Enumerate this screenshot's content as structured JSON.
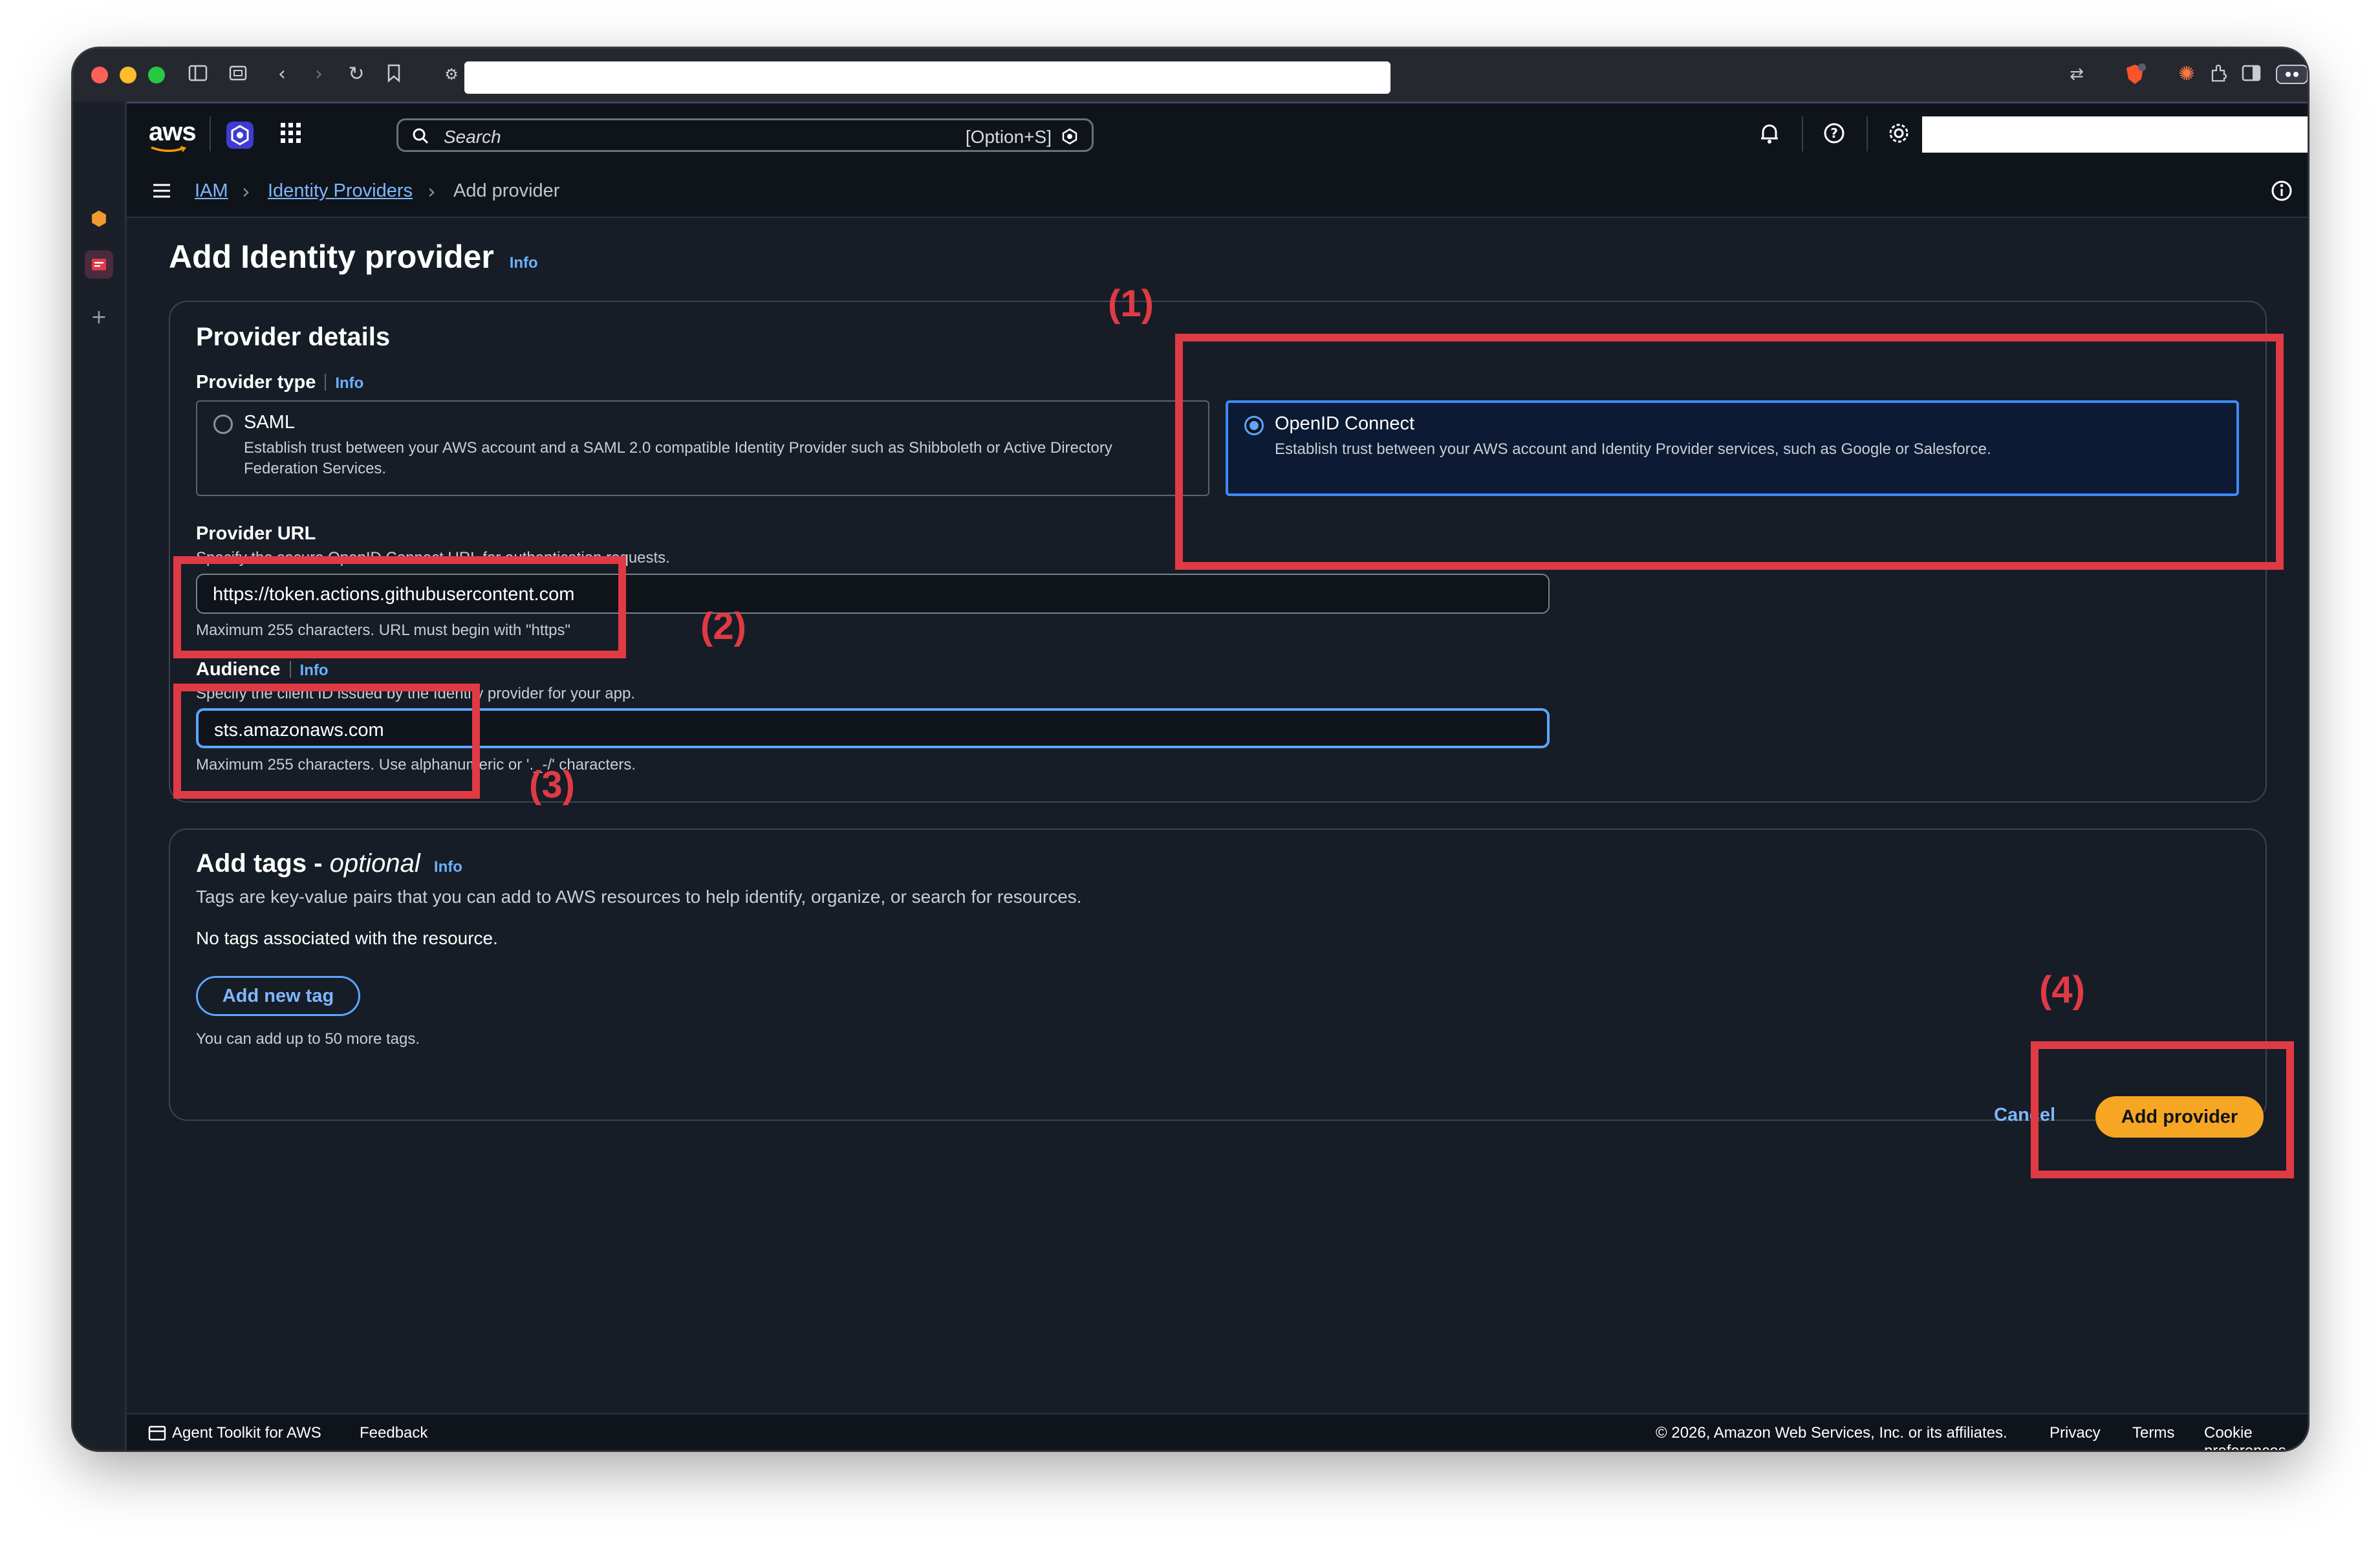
{
  "search": {
    "placeholder": "Search",
    "shortcut": "[Option+S]"
  },
  "breadcrumb": {
    "items": [
      "IAM",
      "Identity Providers",
      "Add provider"
    ]
  },
  "page": {
    "title": "Add Identity provider",
    "info": "Info"
  },
  "provider_details": {
    "heading": "Provider details",
    "provider_type_label": "Provider type",
    "info": "Info",
    "options": [
      {
        "title": "SAML",
        "description": "Establish trust between your AWS account and a SAML 2.0 compatible Identity Provider such as Shibboleth or Active Directory Federation Services.",
        "selected": false
      },
      {
        "title": "OpenID Connect",
        "description": "Establish trust between your AWS account and Identity Provider services, such as Google or Salesforce.",
        "selected": true
      }
    ],
    "provider_url": {
      "label": "Provider URL",
      "description": "Specify the secure OpenID Connect URL for authentication requests.",
      "value": "https://token.actions.githubusercontent.com",
      "constraint": "Maximum 255 characters. URL must begin with \"https\""
    },
    "audience": {
      "label": "Audience",
      "info": "Info",
      "description": "Specify the client ID issued by the Identity provider for your app.",
      "value": "sts.amazonaws.com",
      "constraint": "Maximum 255 characters. Use alphanumeric or '._-/' characters."
    }
  },
  "tags": {
    "heading_main": "Add tags - ",
    "heading_optional": "optional",
    "info": "Info",
    "description": "Tags are key-value pairs that you can add to AWS resources to help identify, organize, or search for resources.",
    "empty_text": "No tags associated with the resource.",
    "add_button": "Add new tag",
    "limit_text": "You can add up to 50 more tags."
  },
  "actions": {
    "cancel": "Cancel",
    "submit": "Add provider"
  },
  "annotations": [
    "(1)",
    "(2)",
    "(3)",
    "(4)"
  ],
  "footer": {
    "toolkit": "Agent Toolkit for AWS",
    "feedback": "Feedback",
    "copyright": "© 2026, Amazon Web Services, Inc. or its affiliates.",
    "privacy": "Privacy",
    "terms": "Terms",
    "cookies": "Cookie preferences"
  },
  "colors": {
    "accent": "#f7a623",
    "link": "#7fb6ff",
    "annotation": "#e03a45",
    "background": "#161d26"
  }
}
